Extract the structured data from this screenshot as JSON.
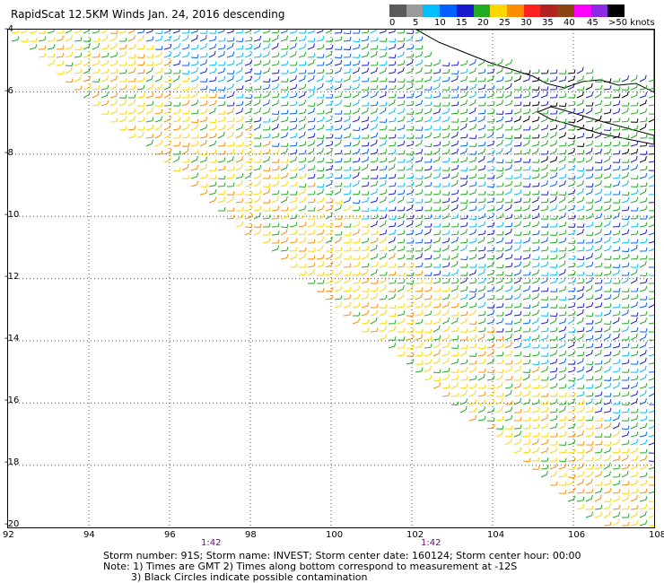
{
  "title": "RapidScat 12.5KM Winds Jan. 24, 2016 descending",
  "scale": {
    "ticks": [
      "0",
      "5",
      "10",
      "15",
      "20",
      "25",
      "30",
      "35",
      "40",
      "45",
      ">50 knots"
    ],
    "colors": [
      "#5a5a5a",
      "#9a9a9a",
      "#00bfff",
      "#0060ff",
      "#1a1acc",
      "#22aa22",
      "#ffd700",
      "#ff8c00",
      "#ff2020",
      "#b22222",
      "#8b4513",
      "#ff00ff",
      "#8a2be2",
      "#000000"
    ]
  },
  "axes": {
    "lat_labels": [
      "-4",
      "-6",
      "-8",
      "-10",
      "-12",
      "-14",
      "-16",
      "-18",
      "-20"
    ],
    "lon_labels": [
      "92",
      "94",
      "96",
      "98",
      "100",
      "102",
      "104",
      "106",
      "108"
    ]
  },
  "times": [
    "1:42",
    "1:42"
  ],
  "footer": {
    "line1": "Storm number: 91S;   Storm name: INVEST;   Storm center date: 160124;   Storm center hour: 00:00",
    "line2": "Note: 1) Times are GMT  2) Times along bottom correspond to measurement at -12S",
    "line3": "3) Black Circles indicate possible contamination"
  }
}
